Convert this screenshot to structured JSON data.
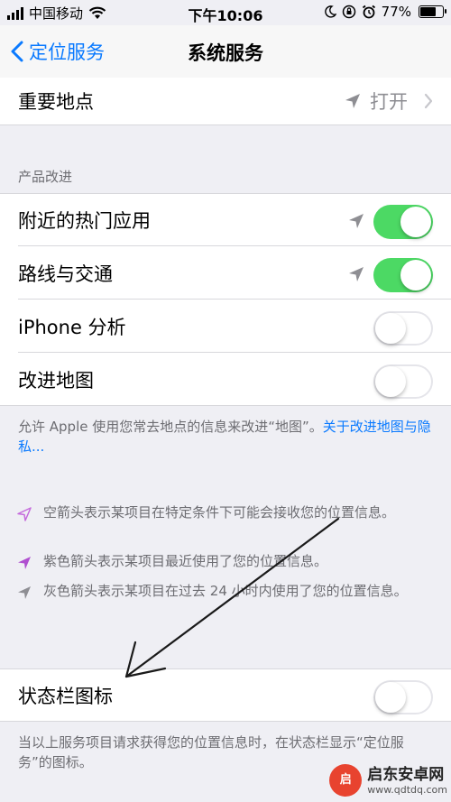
{
  "status_bar": {
    "carrier": "中国移动",
    "time": "下午10:06",
    "battery": "77%",
    "battery_level": 0.77
  },
  "nav": {
    "back_label": "定位服务",
    "title": "系统服务"
  },
  "important_locations": {
    "label": "重要地点",
    "value": "打开"
  },
  "product_improvement": {
    "header": "产品改进",
    "rows": [
      {
        "label": "附近的热门应用",
        "on": true,
        "arrow": true
      },
      {
        "label": "路线与交通",
        "on": true,
        "arrow": true
      },
      {
        "label": "iPhone 分析",
        "on": false,
        "arrow": false
      },
      {
        "label": "改进地图",
        "on": false,
        "arrow": false
      }
    ],
    "footer_text": "允许 Apple 使用您常去地点的信息来改进“地图”。",
    "footer_link": "关于改进地图与隐私..."
  },
  "legend": [
    {
      "icon": "hollow-purple-arrow-icon",
      "text": "空箭头表示某项目在特定条件下可能会接收您的位置信息。"
    },
    {
      "icon": "purple-arrow-icon",
      "text": "紫色箭头表示某项目最近使用了您的位置信息。"
    },
    {
      "icon": "gray-arrow-icon",
      "text": "灰色箭头表示某项目在过去 24 小时内使用了您的位置信息。"
    }
  ],
  "status_bar_icon": {
    "label": "状态栏图标",
    "on": false,
    "footer": "当以上服务项目请求获得您的位置信息时，在状态栏显示“定位服务”的图标。"
  },
  "watermark": {
    "logo_text": "启",
    "title": "启东安卓网",
    "url": "www.qdtdq.com"
  },
  "colors": {
    "accent": "#0a7aff",
    "toggle_on": "#4cd964",
    "purple": "#c56bdc",
    "background": "#efeff4"
  }
}
